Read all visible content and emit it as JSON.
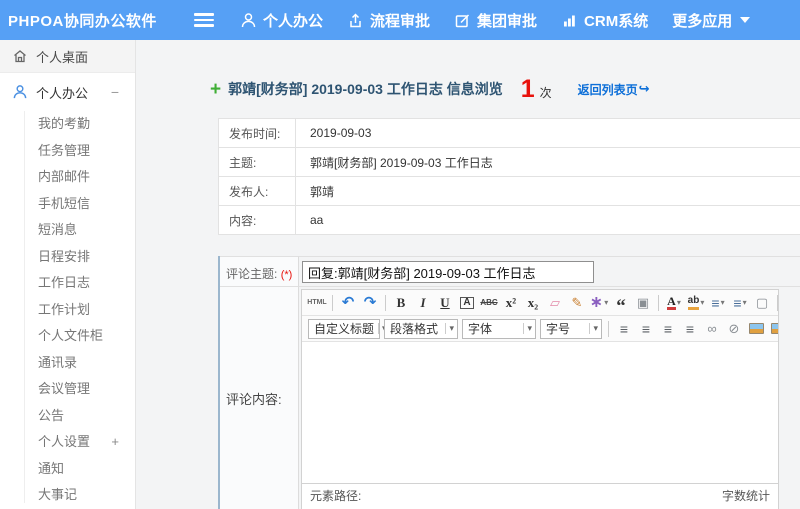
{
  "colors": {
    "topbar_blue": "#56a0f5",
    "accent_red": "#e8120c",
    "link_blue": "#0d6fd8",
    "title_navy": "#2e5472",
    "plus_green": "#3fae35"
  },
  "topbar": {
    "logo": "PHPOA协同办公软件",
    "nav": [
      {
        "label": "个人办公"
      },
      {
        "label": "流程审批"
      },
      {
        "label": "集团审批"
      },
      {
        "label": "CRM系统"
      },
      {
        "label": "更多应用"
      }
    ]
  },
  "sidebar": {
    "desktop_label": "个人桌面",
    "section": {
      "label": "个人办公",
      "collapse_glyph": "−"
    },
    "items": [
      {
        "name": "my-attendance",
        "label": "我的考勤"
      },
      {
        "name": "task-management",
        "label": "任务管理"
      },
      {
        "name": "internal-mail",
        "label": "内部邮件"
      },
      {
        "name": "mobile-sms",
        "label": "手机短信"
      },
      {
        "name": "short-message",
        "label": "短消息"
      },
      {
        "name": "schedule",
        "label": "日程安排"
      },
      {
        "name": "work-log",
        "label": "工作日志"
      },
      {
        "name": "work-plan",
        "label": "工作计划"
      },
      {
        "name": "personal-file-cabinet",
        "label": "个人文件柜"
      },
      {
        "name": "contacts",
        "label": "通讯录"
      },
      {
        "name": "meeting-management",
        "label": "会议管理"
      },
      {
        "name": "announcement",
        "label": "公告"
      },
      {
        "name": "personal-settings",
        "label": "个人设置",
        "suffix": "+"
      },
      {
        "name": "notification",
        "label": "通知"
      },
      {
        "name": "memorabilia",
        "label": "大事记"
      }
    ]
  },
  "main": {
    "plus_glyph": "+",
    "title": "郭靖[财务部] 2019-09-03 工作日志 信息浏览",
    "view_count": "1",
    "view_count_unit": "次",
    "back_link": "返回列表页",
    "back_arrow_glyph": "↪",
    "info_rows": [
      {
        "name": "publish-time",
        "label": "发布时间:",
        "value": "2019-09-03"
      },
      {
        "name": "subject",
        "label": "主题:",
        "value": "郭靖[财务部] 2019-09-03 工作日志"
      },
      {
        "name": "publisher",
        "label": "发布人:",
        "value": "郭靖"
      },
      {
        "name": "content",
        "label": "内容:",
        "value": "aa"
      }
    ],
    "comment": {
      "subject_label": "评论主题:",
      "required_mark": "(*)",
      "subject_value": "回复:郭靖[财务部] 2019-09-03 工作日志",
      "content_label": "评论内容:"
    },
    "editor": {
      "toolbar_row1": [
        {
          "name": "html-source-button",
          "glyph": "HTML",
          "cls": "t-html"
        },
        {
          "name": "separator"
        },
        {
          "name": "undo-icon",
          "glyph": "↶",
          "cls": "t-blue"
        },
        {
          "name": "redo-icon",
          "glyph": "↷",
          "cls": "t-blue"
        },
        {
          "name": "separator"
        },
        {
          "name": "bold-icon",
          "glyph": "B",
          "cls": "t-serif"
        },
        {
          "name": "italic-icon",
          "glyph": "I",
          "cls": "t-serif t-italic"
        },
        {
          "name": "underline-icon",
          "glyph": "U",
          "cls": "t-serif t-underline"
        },
        {
          "name": "font-border-icon",
          "glyph": "A",
          "cls": "t-boxed"
        },
        {
          "name": "strikethrough-icon",
          "glyph": "ABC",
          "cls": "t-strike"
        },
        {
          "name": "superscript-icon",
          "glyph": "x²",
          "cls": "t-serif"
        },
        {
          "name": "subscript-icon",
          "glyph": "x₂",
          "cls": "t-serif"
        },
        {
          "name": "eraser-icon",
          "glyph": "▱",
          "cls": "t-pink"
        },
        {
          "name": "format-painter-icon",
          "glyph": "✎",
          "cls": "t-orange"
        },
        {
          "name": "auto-typeset-icon",
          "glyph": "∗",
          "cls": "t-purple",
          "caret": true
        },
        {
          "name": "blockquote-icon",
          "glyph": "“",
          "cls": "t-quote"
        },
        {
          "name": "paste-plain-icon",
          "glyph": "▣",
          "cls": "t-gray"
        },
        {
          "name": "separator"
        },
        {
          "name": "font-color-icon",
          "glyph": "A",
          "cls": "t-forecolor",
          "caret": true
        },
        {
          "name": "highlight-color-icon",
          "glyph": "ab",
          "cls": "t-backcolor",
          "caret": true
        },
        {
          "name": "ordered-list-icon",
          "glyph": "≡",
          "cls": "t-list",
          "caret": true
        },
        {
          "name": "unordered-list-icon",
          "glyph": "≡",
          "cls": "t-list",
          "caret": true
        },
        {
          "name": "blank-doc-icon",
          "glyph": "▢",
          "cls": "t-gray"
        },
        {
          "name": "separator"
        },
        {
          "name": "preview-icon",
          "glyph": "",
          "cls": "t-monitor"
        }
      ],
      "toolbar_row2": [
        {
          "name": "heading-select",
          "select": true,
          "label": "自定义标题"
        },
        {
          "name": "paragraph-format-select",
          "select": true,
          "label": "段落格式"
        },
        {
          "name": "font-family-select",
          "select": true,
          "label": "字体"
        },
        {
          "name": "font-size-select",
          "select": true,
          "label": "字号"
        },
        {
          "name": "separator"
        },
        {
          "name": "align-left-icon",
          "glyph": "≡",
          "cls": "t-align"
        },
        {
          "name": "align-center-icon",
          "glyph": "≡",
          "cls": "t-align"
        },
        {
          "name": "align-right-icon",
          "glyph": "≡",
          "cls": "t-align"
        },
        {
          "name": "align-justify-icon",
          "glyph": "≡",
          "cls": "t-align"
        },
        {
          "name": "link-icon",
          "glyph": "∞",
          "cls": "t-gray"
        },
        {
          "name": "unlink-icon",
          "glyph": "⊘",
          "cls": "t-gray"
        },
        {
          "name": "insert-image-icon",
          "glyph": "",
          "cls": "t-img"
        },
        {
          "name": "screenshot-icon",
          "glyph": "",
          "cls": "t-img t-img2"
        },
        {
          "name": "insert-media-icon",
          "glyph": "",
          "cls": "t-media"
        },
        {
          "name": "insert-table-icon",
          "glyph": "▦",
          "cls": "t-table"
        }
      ],
      "status_left": "元素路径:",
      "status_right": "字数统计"
    }
  }
}
